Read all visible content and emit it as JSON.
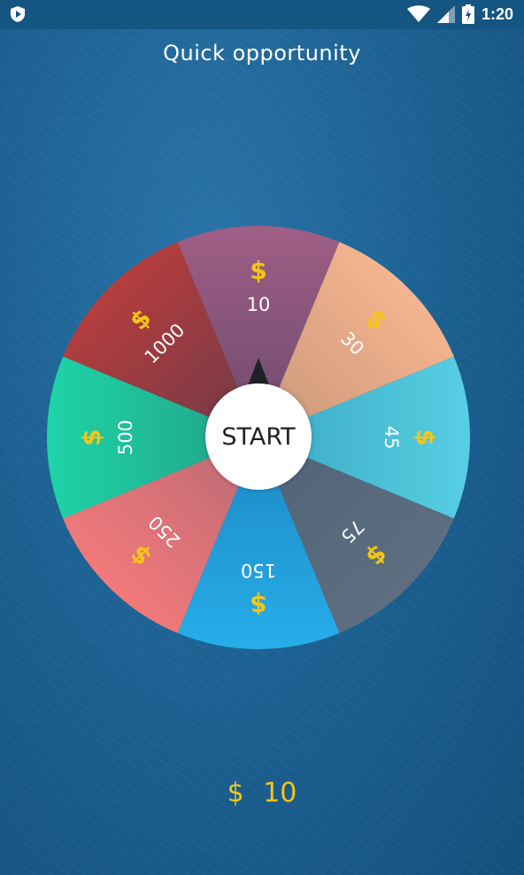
{
  "status_bar": {
    "time": "1:20",
    "icons": [
      "app-shield-icon",
      "wifi-icon",
      "cell-signal-icon",
      "battery-charging-icon"
    ]
  },
  "title": "Quick opportunity",
  "wheel": {
    "segments": [
      {
        "value": "10",
        "currency": "$",
        "color_start": "#a05e86",
        "color_end": "#6c4a6c"
      },
      {
        "value": "30",
        "currency": "$",
        "color_start": "#f5b48f",
        "color_end": "#c8977a"
      },
      {
        "value": "45",
        "currency": "$",
        "color_start": "#57cfe3",
        "color_end": "#3aaac2"
      },
      {
        "value": "75",
        "currency": "$",
        "color_start": "#5d6e80",
        "color_end": "#4f6378"
      },
      {
        "value": "150",
        "currency": "$",
        "color_start": "#26aee8",
        "color_end": "#1e88c4"
      },
      {
        "value": "250",
        "currency": "$",
        "color_start": "#f27979",
        "color_end": "#b86a75"
      },
      {
        "value": "500",
        "currency": "$",
        "color_start": "#1fd4a8",
        "color_end": "#20a085"
      },
      {
        "value": "1000",
        "currency": "$",
        "color_start": "#b53d3d",
        "color_end": "#6e3a48"
      }
    ],
    "start_label": "START",
    "currency_color": "#f5c518",
    "label_color": "#ffffff"
  },
  "result": {
    "currency": "$",
    "amount": "10"
  },
  "colors": {
    "background": "#1d6394",
    "status_bar": "#155582",
    "accent": "#f5c518"
  }
}
